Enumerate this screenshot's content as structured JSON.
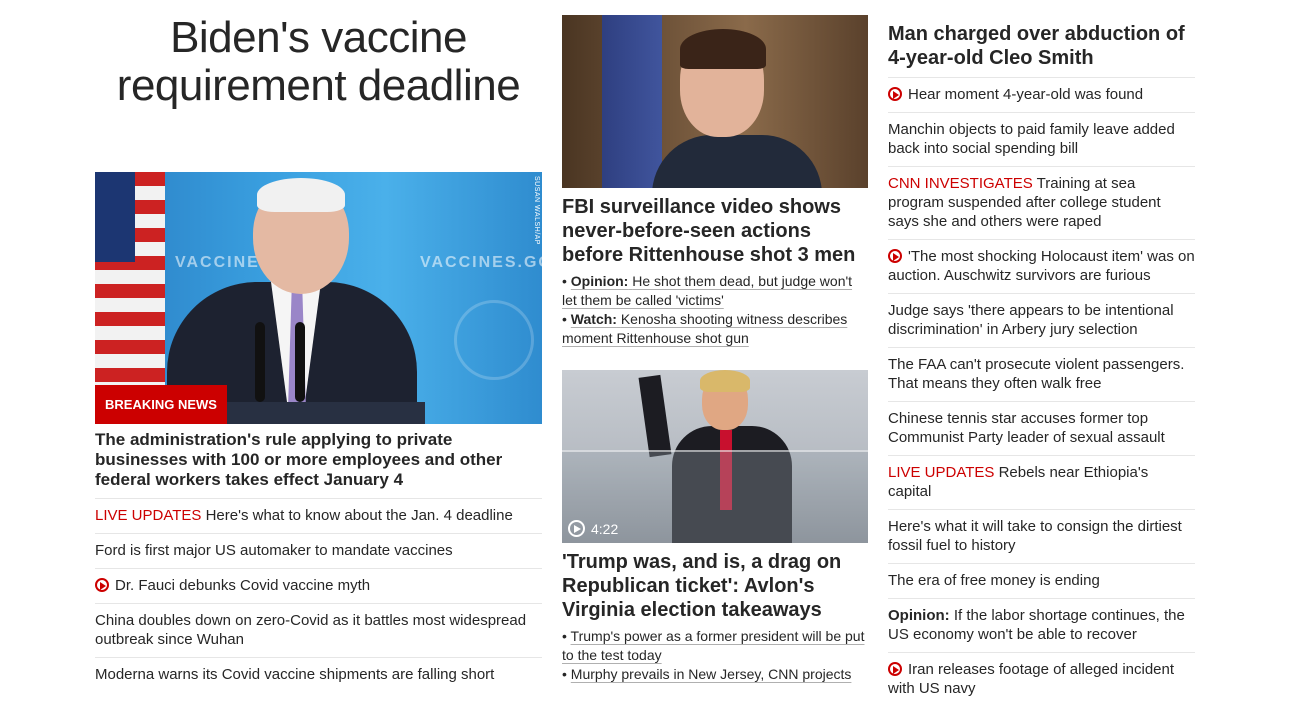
{
  "left": {
    "headline": "Biden's vaccine requirement deadline",
    "image_credit": "SUSAN WALSH/AP",
    "image_text_left": "VACCINES",
    "image_text_right": "VACCINES.GO",
    "breaking_label": "BREAKING NEWS",
    "lead": "The administration's rule applying to private businesses with 100 or more employees and other federal workers takes effect January 4",
    "items": [
      {
        "prefix": "LIVE UPDATES",
        "text": " Here's what to know about the Jan. 4 deadline"
      },
      {
        "text": "Ford is first major US automaker to mandate vaccines"
      },
      {
        "text": "Dr. Fauci debunks Covid vaccine myth",
        "icon": "play-icon"
      },
      {
        "text": "China doubles down on zero-Covid as it battles most widespread outbreak since Wuhan"
      },
      {
        "text": "Moderna warns its Covid vaccine shipments are falling short"
      }
    ]
  },
  "middle": {
    "story1": {
      "headline": "FBI surveillance video shows never-before-seen actions before Rittenhouse shot 3 men",
      "subs": [
        {
          "bullet": "•",
          "label": "Opinion:",
          "text": "He shot them dead, but judge won't let them be called 'victims'"
        },
        {
          "bullet": "•",
          "label": "Watch:",
          "text": "Kenosha shooting witness describes moment Rittenhouse shot gun"
        }
      ]
    },
    "story2": {
      "video_duration": "4:22",
      "headline": "'Trump was, and is, a drag on Republican ticket': Avlon's Virginia election takeaways",
      "subs": [
        {
          "bullet": "•",
          "text": "Trump's power as a former president will be put to the test today"
        },
        {
          "bullet": "•",
          "text": "Murphy prevails in New Jersey, CNN projects"
        }
      ]
    }
  },
  "right": {
    "headline": "Man charged over abduction of 4-year-old Cleo Smith",
    "items": [
      {
        "text": "Hear moment 4-year-old was found",
        "icon": "play-icon"
      },
      {
        "text": "Manchin objects to paid family leave added back into social spending bill"
      },
      {
        "prefix": "CNN INVESTIGATES",
        "text": " Training at sea program suspended after college student says she and others were raped"
      },
      {
        "text": "'The most shocking Holocaust item' was on auction. Auschwitz survivors are furious",
        "icon": "play-icon"
      },
      {
        "text": "Judge says 'there appears to be intentional discrimination' in Arbery jury selection"
      },
      {
        "text": "The FAA can't prosecute violent passengers. That means they often walk free"
      },
      {
        "text": "Chinese tennis star accuses former top Communist Party leader of sexual assault"
      },
      {
        "prefix": "LIVE UPDATES",
        "text": " Rebels near Ethiopia's capital"
      },
      {
        "text": "Here's what it will take to consign the dirtiest fossil fuel to history"
      },
      {
        "text": "The era of free money is ending"
      },
      {
        "label": "Opinion:",
        "text": " If the labor shortage continues, the US economy won't be able to recover"
      },
      {
        "text": "Iran releases footage of alleged incident with US navy",
        "icon": "play-icon"
      }
    ]
  },
  "colors": {
    "accent_red": "#cc0000",
    "text": "#262626",
    "divider": "#e6e6e6"
  }
}
